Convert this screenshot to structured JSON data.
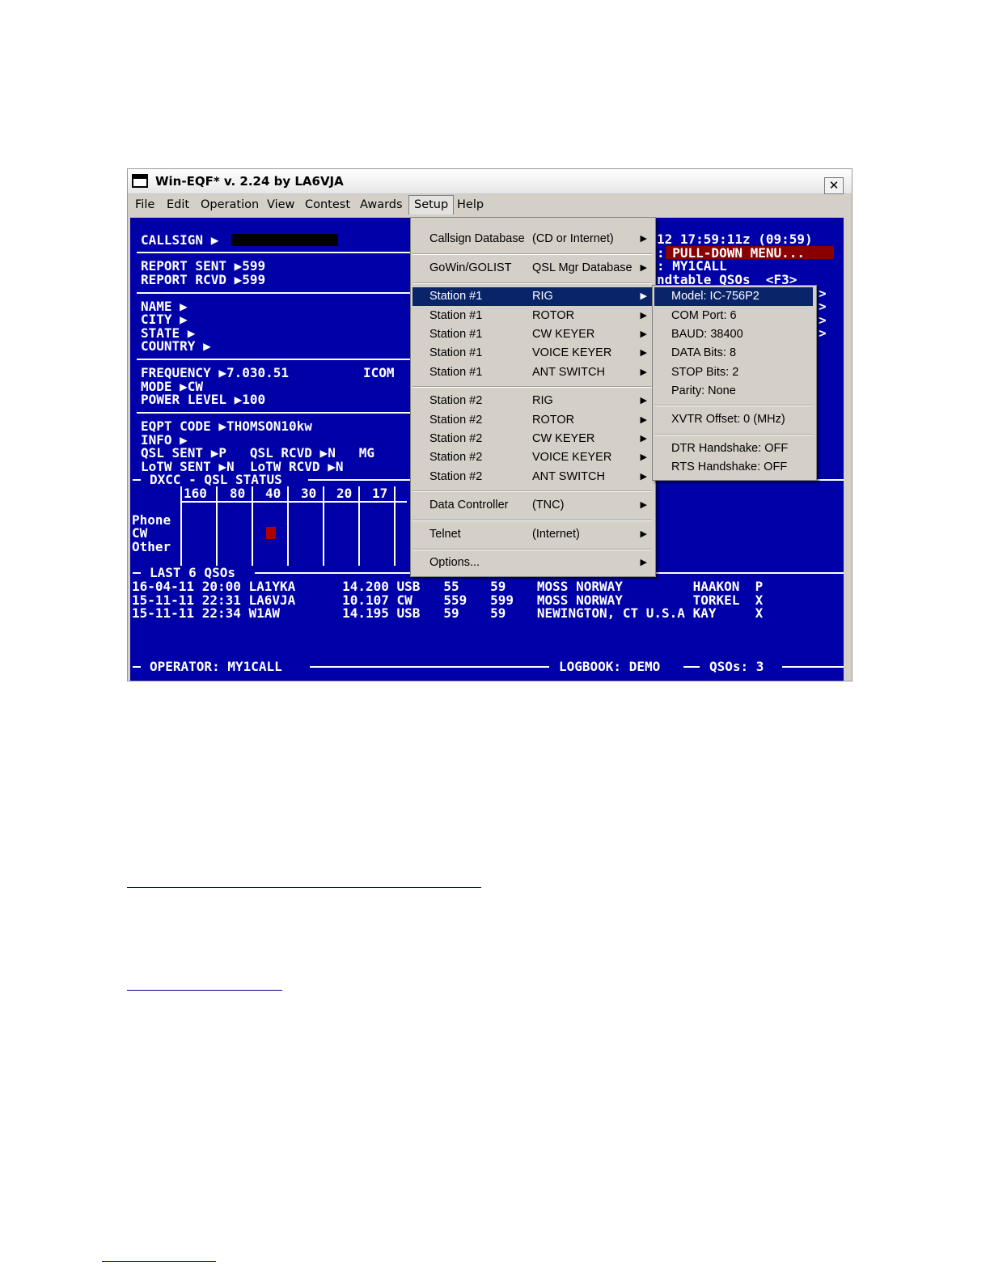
{
  "window": {
    "title": "Win-EQF* v. 2.24 by LA6VJA",
    "close_glyph": "✕"
  },
  "menubar": [
    "File",
    "Edit",
    "Operation",
    "View",
    "Contest",
    "Awards",
    "Setup",
    "Help"
  ],
  "screen": {
    "callsign_label": "CALLSIGN ▶",
    "header_time": "12 17:59:11z (09:59)",
    "header_hint": ": PULL-DOWN MENU...",
    "header_op": ": MY1CALL",
    "header_qsos": "ndtable QSOs  <F3>",
    "right_arrows": [
      ">",
      ">",
      ">",
      ">"
    ],
    "report_sent": "REPORT SENT ▶599",
    "report_rcvd": "REPORT RCVD ▶599",
    "name": "NAME ▶",
    "city": "CITY ▶",
    "state": "STATE ▶",
    "country": "COUNTRY ▶",
    "frequency": "FREQUENCY ▶7.030.51",
    "rig": "ICOM",
    "mode": "MODE ▶CW",
    "power": "POWER LEVEL ▶100",
    "eqpt": "EQPT CODE ▶THOMSON10kw",
    "info": "INFO ▶",
    "qsl_line": "QSL SENT ▶P   QSL RCVD ▶N   MG",
    "lotw_line": "LoTW SENT ▶N  LoTW RCVD ▶N",
    "dxcc_title": "DXCC - QSL STATUS",
    "bands": [
      "160",
      "80",
      "40",
      "30",
      "20",
      "17"
    ],
    "modes": [
      "Phone",
      "CW",
      "Other"
    ],
    "last_title": "LAST 6 QSOs",
    "qsos": [
      "16-04-11 20:00 LA1YKA      14.200 USB   55    59    MOSS NORWAY         HAAKON  P",
      "15-11-11 22:31 LA6VJA      10.107 CW    559   599   MOSS NORWAY         TORKEL  X",
      "15-11-11 22:34 W1AW        14.195 USB   59    59    NEWINGTON, CT U.S.A KAY     X"
    ],
    "operator": "OPERATOR: MY1CALL",
    "logbook": "LOGBOOK: DEMO",
    "qso_count": "QSOs: 3"
  },
  "setup_menu": [
    {
      "c1": "Callsign Database",
      "c2": "(CD or Internet)"
    },
    {
      "c1": "GoWin/GOLIST",
      "c2": "QSL Mgr Database"
    },
    {
      "c1": "Station #1",
      "c2": "RIG"
    },
    {
      "c1": "Station #1",
      "c2": "ROTOR"
    },
    {
      "c1": "Station #1",
      "c2": "CW KEYER"
    },
    {
      "c1": "Station #1",
      "c2": "VOICE KEYER"
    },
    {
      "c1": "Station #1",
      "c2": "ANT SWITCH"
    },
    {
      "c1": "Station #2",
      "c2": "RIG"
    },
    {
      "c1": "Station #2",
      "c2": "ROTOR"
    },
    {
      "c1": "Station #2",
      "c2": "CW KEYER"
    },
    {
      "c1": "Station #2",
      "c2": "VOICE KEYER"
    },
    {
      "c1": "Station #2",
      "c2": "ANT SWITCH"
    },
    {
      "c1": "Data Controller",
      "c2": "(TNC)"
    },
    {
      "c1": "Telnet",
      "c2": "(Internet)"
    },
    {
      "c1": "Options...",
      "c2": ""
    }
  ],
  "rig_submenu": [
    "Model: IC-756P2",
    "COM Port: 6",
    "BAUD: 38400",
    "DATA Bits: 8",
    "STOP Bits: 2",
    "Parity: None",
    "XVTR Offset: 0  (MHz)",
    "DTR Handshake: OFF",
    "RTS Handshake: OFF"
  ],
  "icons": {
    "submenu_arrow": "▶",
    "app": "console-window-icon"
  },
  "colors": {
    "screen_bg": "#0000a8",
    "highlight": "#0a246a",
    "alert": "#8a0000"
  }
}
